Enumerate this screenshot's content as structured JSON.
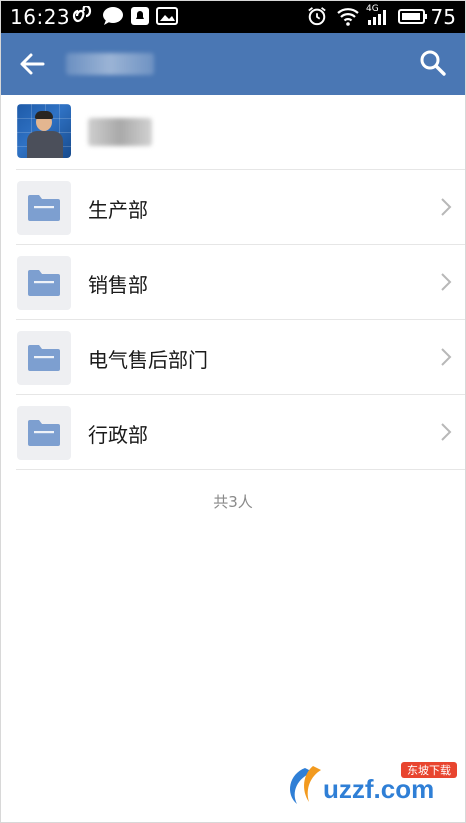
{
  "status_bar": {
    "time": "16:23",
    "network": "4G",
    "battery_level": "75"
  },
  "app_bar": {
    "back_icon": "arrow-left-icon",
    "search_icon": "search-icon",
    "color": "#4a77b4"
  },
  "profile": {
    "avatar": "avatar-photo"
  },
  "departments": [
    {
      "label": "生产部",
      "icon": "folder-icon"
    },
    {
      "label": "销售部",
      "icon": "folder-icon"
    },
    {
      "label": "电气售后部门",
      "icon": "folder-icon"
    },
    {
      "label": "行政部",
      "icon": "folder-icon"
    }
  ],
  "footer": {
    "count_text": "共3人"
  },
  "watermark": {
    "brand": "uzzf.com",
    "tag": "东坡下载"
  }
}
